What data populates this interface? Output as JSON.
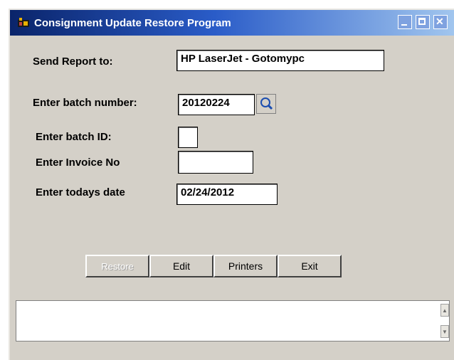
{
  "window": {
    "title": "Consignment Update Restore Program"
  },
  "form": {
    "send_report_label": "Send Report to:",
    "send_report_value": "HP LaserJet - Gotomypc",
    "batch_number_label": "Enter batch number:",
    "batch_number_value": "20120224",
    "batch_id_label": "Enter batch ID:",
    "batch_id_value": "",
    "invoice_label": "Enter Invoice No",
    "invoice_value": "",
    "date_label": "Enter todays date",
    "date_value": "02/24/2012"
  },
  "buttons": {
    "restore": "Restore",
    "edit": "Edit",
    "printers": "Printers",
    "exit": "Exit"
  },
  "status": {
    "text": ""
  }
}
